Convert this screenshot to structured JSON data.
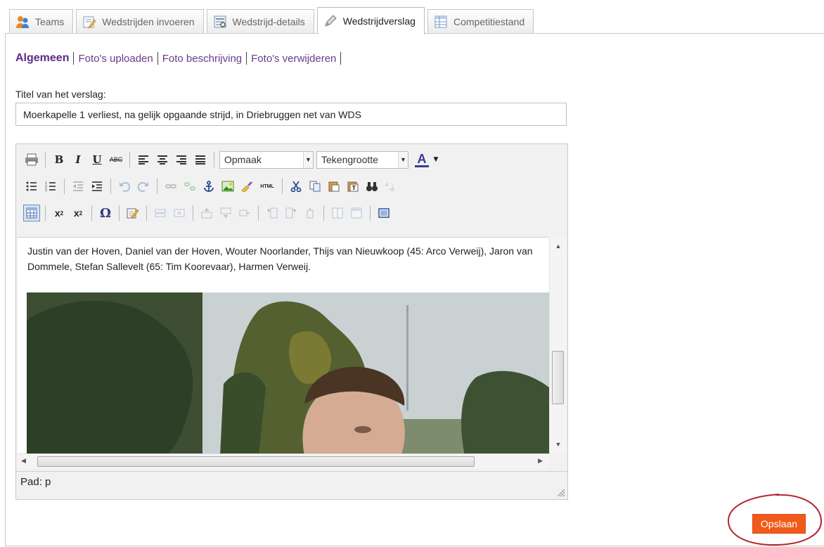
{
  "tabs": [
    {
      "label": "Teams",
      "icon": "teams-icon",
      "active": false
    },
    {
      "label": "Wedstrijden invoeren",
      "icon": "edit-form-icon",
      "active": false
    },
    {
      "label": "Wedstrijd-details",
      "icon": "details-icon",
      "active": false
    },
    {
      "label": "Wedstrijdverslag",
      "icon": "pencil-icon",
      "active": true
    },
    {
      "label": "Competitiestand",
      "icon": "table-icon",
      "active": false
    }
  ],
  "subnav": {
    "items": [
      "Algemeen",
      "Foto's uploaden",
      "Foto beschrijving",
      "Foto's verwijderen"
    ]
  },
  "form": {
    "title_label": "Titel van het verslag:",
    "title_value": "Moerkapelle 1 verliest, na gelijk opgaande strijd, in Driebruggen net van WDS"
  },
  "editor": {
    "format_select": "Opmaak",
    "fontsize_select": "Tekengrootte",
    "content_text": "Justin van der Hoven, Daniel van der Hoven, Wouter Noorlander, Thijs van Nieuwkoop (45: Arco Verweij),  Jaron van Dommele, Stefan Sallevelt (65: Tim Koorevaar), Harmen Verweij.",
    "path_label": "Pad: p"
  },
  "actions": {
    "save_label": "Opslaan",
    "save_color": "#f05a1a",
    "highlight_color": "#b0262e"
  },
  "colors": {
    "link": "#6b3a8b",
    "border": "#c9c9c9"
  }
}
